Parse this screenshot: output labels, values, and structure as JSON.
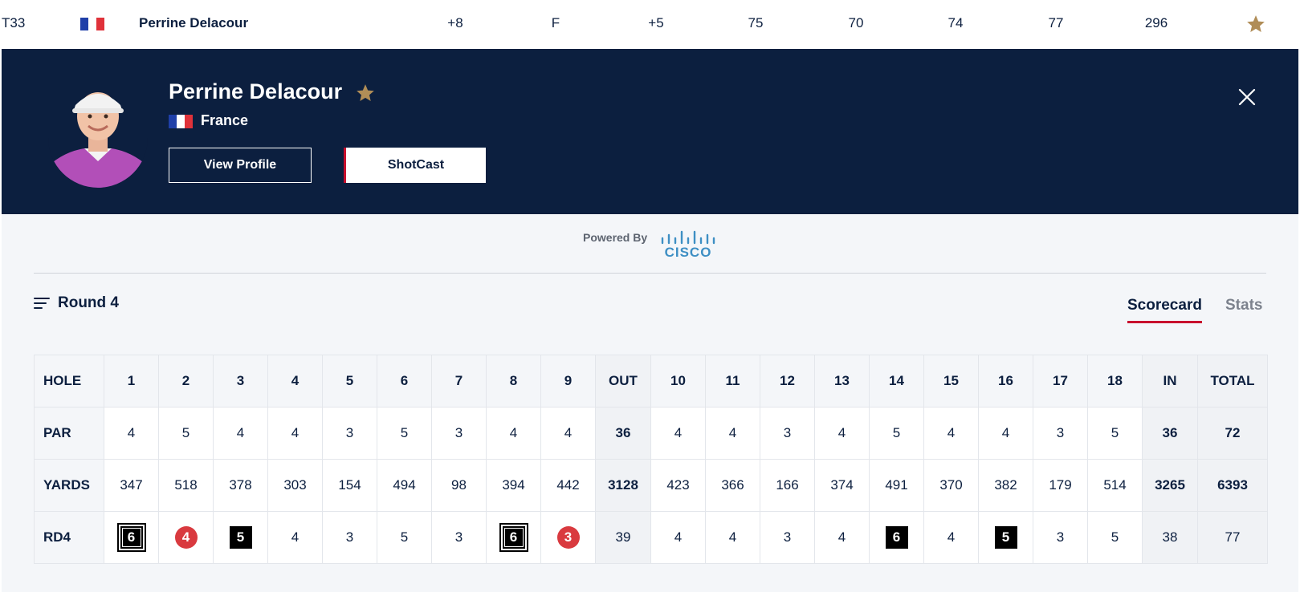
{
  "leaderboard_row": {
    "position": "T33",
    "player": "Perrine Delacour",
    "to_par": "+8",
    "thru": "F",
    "today": "+5",
    "r1": "75",
    "r2": "70",
    "r3": "74",
    "r4": "77",
    "total": "296"
  },
  "player_panel": {
    "name": "Perrine Delacour",
    "country": "France",
    "view_profile_label": "View Profile",
    "shotcast_label": "ShotCast"
  },
  "sponsor": {
    "powered_by": "Powered By",
    "brand": "CISCO"
  },
  "round_selector": {
    "label": "Round 4"
  },
  "tabs": {
    "scorecard": "Scorecard",
    "stats": "Stats"
  },
  "scorecard": {
    "row_labels": {
      "hole": "HOLE",
      "par": "PAR",
      "yards": "YARDS",
      "round": "RD4"
    },
    "holes": [
      "1",
      "2",
      "3",
      "4",
      "5",
      "6",
      "7",
      "8",
      "9",
      "OUT",
      "10",
      "11",
      "12",
      "13",
      "14",
      "15",
      "16",
      "17",
      "18",
      "IN",
      "TOTAL"
    ],
    "par": [
      "4",
      "5",
      "4",
      "4",
      "3",
      "5",
      "3",
      "4",
      "4",
      "36",
      "4",
      "4",
      "3",
      "4",
      "5",
      "4",
      "4",
      "3",
      "5",
      "36",
      "72"
    ],
    "yards": [
      "347",
      "518",
      "378",
      "303",
      "154",
      "494",
      "98",
      "394",
      "442",
      "3128",
      "423",
      "366",
      "166",
      "374",
      "491",
      "370",
      "382",
      "179",
      "514",
      "3265",
      "6393"
    ],
    "rd4": [
      "6",
      "4",
      "5",
      "4",
      "3",
      "5",
      "3",
      "6",
      "3",
      "39",
      "4",
      "4",
      "3",
      "4",
      "6",
      "4",
      "5",
      "3",
      "5",
      "38",
      "77"
    ],
    "rd4_marks": [
      "dbl",
      "birdie",
      "bogey",
      "",
      "",
      "",
      "",
      "dbl",
      "birdie",
      "",
      "",
      "",
      "",
      "",
      "bogey",
      "",
      "bogey",
      "",
      "",
      "",
      ""
    ]
  },
  "colors": {
    "navy": "#0c1f3f",
    "accent_red": "#c8102e",
    "birdie_red": "#d93a3f",
    "gold_star": "#b08d57",
    "cisco_blue": "#3e8fc4"
  }
}
